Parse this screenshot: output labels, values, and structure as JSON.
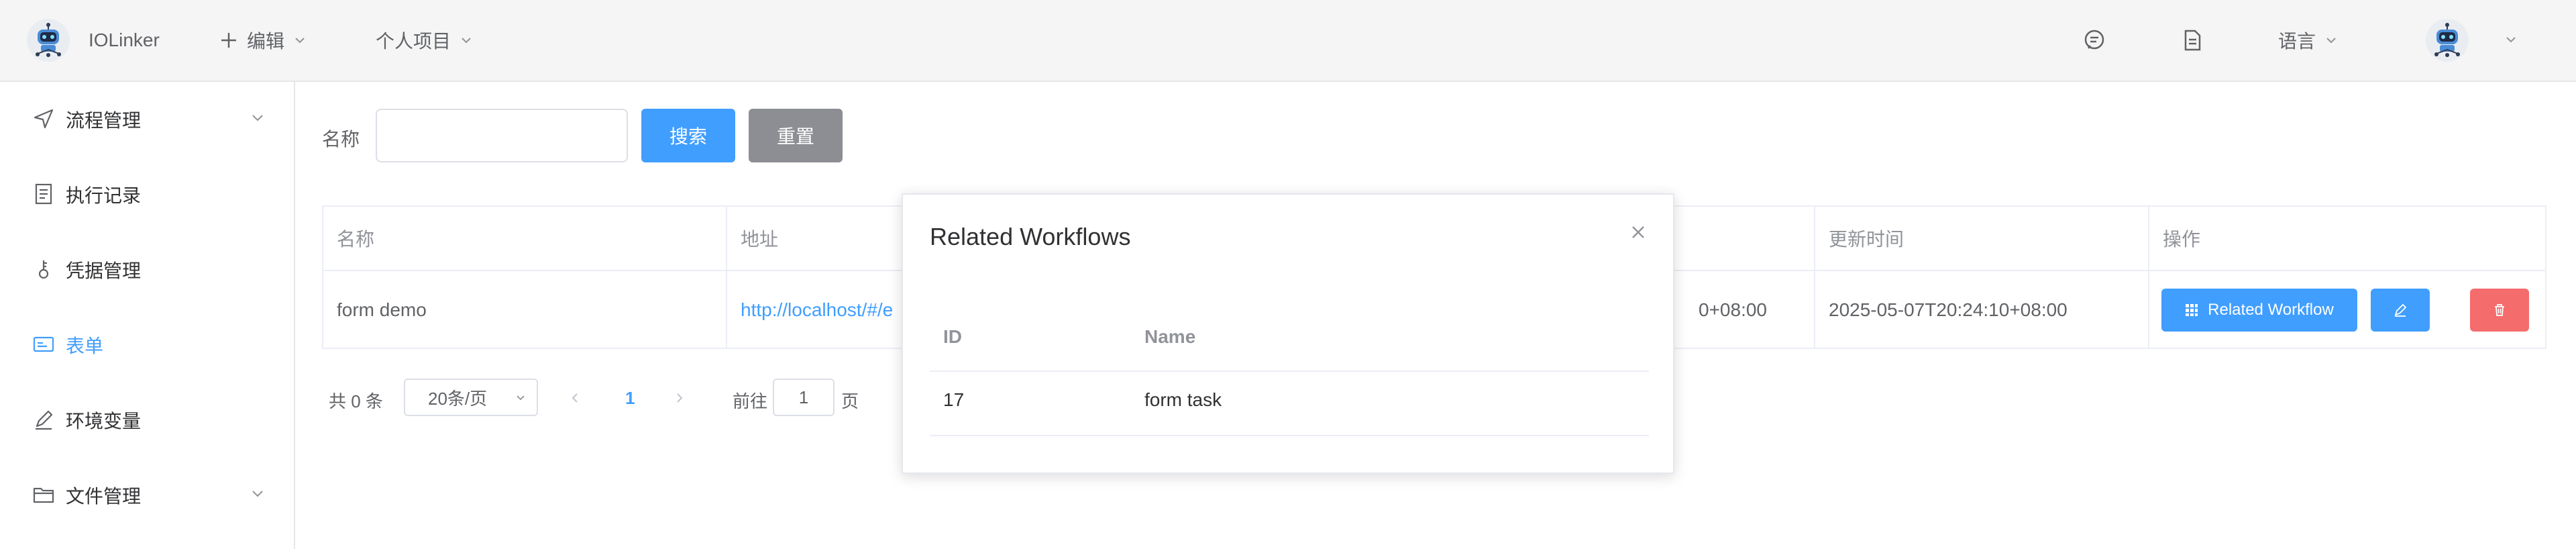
{
  "header": {
    "app_title": "IOLinker",
    "edit_menu": "编辑",
    "project_menu": "个人项目",
    "language_menu": "语言"
  },
  "sidebar": {
    "items": [
      {
        "label": "流程管理",
        "icon": "send-icon",
        "has_chevron": true
      },
      {
        "label": "执行记录",
        "icon": "document-icon",
        "has_chevron": false
      },
      {
        "label": "凭据管理",
        "icon": "key-icon",
        "has_chevron": false
      },
      {
        "label": "表单",
        "icon": "card-icon",
        "has_chevron": false,
        "active": true
      },
      {
        "label": "环境变量",
        "icon": "pen-icon",
        "has_chevron": false
      },
      {
        "label": "文件管理",
        "icon": "folder-icon",
        "has_chevron": true
      }
    ]
  },
  "search": {
    "label": "名称",
    "value": "",
    "search_button": "搜索",
    "reset_button": "重置"
  },
  "table": {
    "headers": {
      "name": "名称",
      "address": "地址",
      "created": "",
      "updated": "更新时间",
      "actions": "操作"
    },
    "rows": [
      {
        "name": "form demo",
        "address": "http://localhost/#/e",
        "created": "0+08:00",
        "updated": "2025-05-07T20:24:10+08:00",
        "related_button": "Related Workflow"
      }
    ]
  },
  "pagination": {
    "total": "共 0 条",
    "page_size": "20条/页",
    "current_page": "1",
    "goto_label": "前往",
    "goto_value": "1",
    "page_suffix": "页"
  },
  "dialog": {
    "title": "Related Workflows",
    "columns": [
      "ID",
      "Name"
    ],
    "rows": [
      {
        "id": "17",
        "name": "form task"
      }
    ]
  },
  "colors": {
    "primary": "#409eff",
    "reset": "#8c8e93",
    "danger": "#f56c6c"
  }
}
